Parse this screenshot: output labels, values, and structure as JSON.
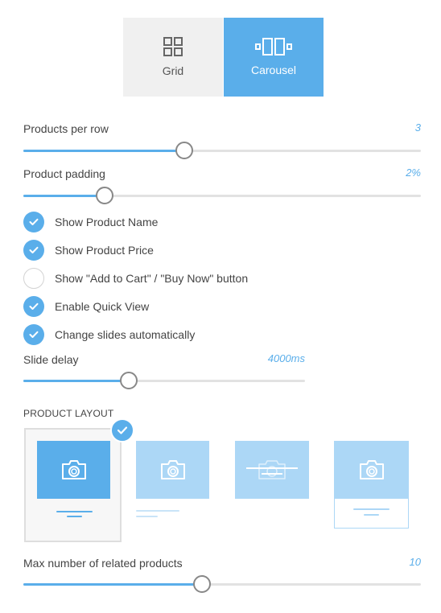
{
  "view_toggle": {
    "grid_label": "Grid",
    "carousel_label": "Carousel",
    "selected": "Carousel"
  },
  "products_per_row": {
    "label": "Products per row",
    "value": "3",
    "fraction": 0.405
  },
  "product_padding": {
    "label": "Product padding",
    "value": "2%",
    "fraction": 0.205
  },
  "checkboxes": [
    {
      "label": "Show Product Name",
      "checked": true
    },
    {
      "label": "Show Product Price",
      "checked": true
    },
    {
      "label": "Show \"Add to Cart\" / \"Buy Now\" button",
      "checked": false
    },
    {
      "label": "Enable Quick View",
      "checked": true
    },
    {
      "label": "Change slides automatically",
      "checked": true
    }
  ],
  "slide_delay": {
    "label": "Slide delay",
    "value": "4000ms",
    "fraction": 0.375
  },
  "product_layout": {
    "title": "PRODUCT LAYOUT",
    "options": [
      "layout-1",
      "layout-2",
      "layout-3",
      "layout-4"
    ],
    "selected": "layout-1"
  },
  "max_related": {
    "label": "Max number of related products",
    "value": "10",
    "fraction": 0.45
  },
  "colors": {
    "accent": "#5aaeea",
    "accent_light": "#acd7f6",
    "track": "#e2e2e2",
    "toggle_bg": "#f0f0f0"
  },
  "icons": [
    "grid-icon",
    "carousel-icon",
    "checkmark-icon",
    "camera-icon"
  ]
}
